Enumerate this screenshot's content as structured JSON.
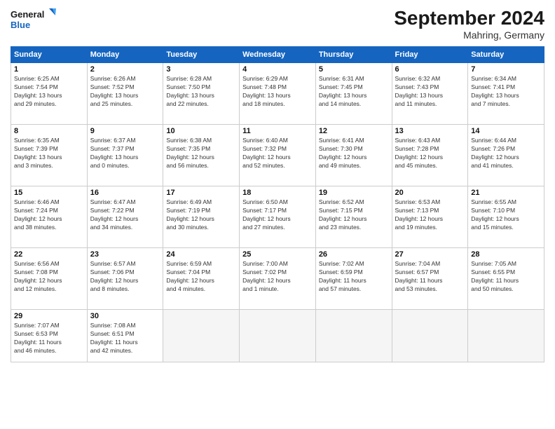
{
  "header": {
    "logo_line1": "General",
    "logo_line2": "Blue",
    "month": "September 2024",
    "location": "Mahring, Germany"
  },
  "columns": [
    "Sunday",
    "Monday",
    "Tuesday",
    "Wednesday",
    "Thursday",
    "Friday",
    "Saturday"
  ],
  "weeks": [
    [
      {
        "day": "1",
        "lines": [
          "Sunrise: 6:25 AM",
          "Sunset: 7:54 PM",
          "Daylight: 13 hours",
          "and 29 minutes."
        ]
      },
      {
        "day": "2",
        "lines": [
          "Sunrise: 6:26 AM",
          "Sunset: 7:52 PM",
          "Daylight: 13 hours",
          "and 25 minutes."
        ]
      },
      {
        "day": "3",
        "lines": [
          "Sunrise: 6:28 AM",
          "Sunset: 7:50 PM",
          "Daylight: 13 hours",
          "and 22 minutes."
        ]
      },
      {
        "day": "4",
        "lines": [
          "Sunrise: 6:29 AM",
          "Sunset: 7:48 PM",
          "Daylight: 13 hours",
          "and 18 minutes."
        ]
      },
      {
        "day": "5",
        "lines": [
          "Sunrise: 6:31 AM",
          "Sunset: 7:45 PM",
          "Daylight: 13 hours",
          "and 14 minutes."
        ]
      },
      {
        "day": "6",
        "lines": [
          "Sunrise: 6:32 AM",
          "Sunset: 7:43 PM",
          "Daylight: 13 hours",
          "and 11 minutes."
        ]
      },
      {
        "day": "7",
        "lines": [
          "Sunrise: 6:34 AM",
          "Sunset: 7:41 PM",
          "Daylight: 13 hours",
          "and 7 minutes."
        ]
      }
    ],
    [
      {
        "day": "8",
        "lines": [
          "Sunrise: 6:35 AM",
          "Sunset: 7:39 PM",
          "Daylight: 13 hours",
          "and 3 minutes."
        ]
      },
      {
        "day": "9",
        "lines": [
          "Sunrise: 6:37 AM",
          "Sunset: 7:37 PM",
          "Daylight: 13 hours",
          "and 0 minutes."
        ]
      },
      {
        "day": "10",
        "lines": [
          "Sunrise: 6:38 AM",
          "Sunset: 7:35 PM",
          "Daylight: 12 hours",
          "and 56 minutes."
        ]
      },
      {
        "day": "11",
        "lines": [
          "Sunrise: 6:40 AM",
          "Sunset: 7:32 PM",
          "Daylight: 12 hours",
          "and 52 minutes."
        ]
      },
      {
        "day": "12",
        "lines": [
          "Sunrise: 6:41 AM",
          "Sunset: 7:30 PM",
          "Daylight: 12 hours",
          "and 49 minutes."
        ]
      },
      {
        "day": "13",
        "lines": [
          "Sunrise: 6:43 AM",
          "Sunset: 7:28 PM",
          "Daylight: 12 hours",
          "and 45 minutes."
        ]
      },
      {
        "day": "14",
        "lines": [
          "Sunrise: 6:44 AM",
          "Sunset: 7:26 PM",
          "Daylight: 12 hours",
          "and 41 minutes."
        ]
      }
    ],
    [
      {
        "day": "15",
        "lines": [
          "Sunrise: 6:46 AM",
          "Sunset: 7:24 PM",
          "Daylight: 12 hours",
          "and 38 minutes."
        ]
      },
      {
        "day": "16",
        "lines": [
          "Sunrise: 6:47 AM",
          "Sunset: 7:22 PM",
          "Daylight: 12 hours",
          "and 34 minutes."
        ]
      },
      {
        "day": "17",
        "lines": [
          "Sunrise: 6:49 AM",
          "Sunset: 7:19 PM",
          "Daylight: 12 hours",
          "and 30 minutes."
        ]
      },
      {
        "day": "18",
        "lines": [
          "Sunrise: 6:50 AM",
          "Sunset: 7:17 PM",
          "Daylight: 12 hours",
          "and 27 minutes."
        ]
      },
      {
        "day": "19",
        "lines": [
          "Sunrise: 6:52 AM",
          "Sunset: 7:15 PM",
          "Daylight: 12 hours",
          "and 23 minutes."
        ]
      },
      {
        "day": "20",
        "lines": [
          "Sunrise: 6:53 AM",
          "Sunset: 7:13 PM",
          "Daylight: 12 hours",
          "and 19 minutes."
        ]
      },
      {
        "day": "21",
        "lines": [
          "Sunrise: 6:55 AM",
          "Sunset: 7:10 PM",
          "Daylight: 12 hours",
          "and 15 minutes."
        ]
      }
    ],
    [
      {
        "day": "22",
        "lines": [
          "Sunrise: 6:56 AM",
          "Sunset: 7:08 PM",
          "Daylight: 12 hours",
          "and 12 minutes."
        ]
      },
      {
        "day": "23",
        "lines": [
          "Sunrise: 6:57 AM",
          "Sunset: 7:06 PM",
          "Daylight: 12 hours",
          "and 8 minutes."
        ]
      },
      {
        "day": "24",
        "lines": [
          "Sunrise: 6:59 AM",
          "Sunset: 7:04 PM",
          "Daylight: 12 hours",
          "and 4 minutes."
        ]
      },
      {
        "day": "25",
        "lines": [
          "Sunrise: 7:00 AM",
          "Sunset: 7:02 PM",
          "Daylight: 12 hours",
          "and 1 minute."
        ]
      },
      {
        "day": "26",
        "lines": [
          "Sunrise: 7:02 AM",
          "Sunset: 6:59 PM",
          "Daylight: 11 hours",
          "and 57 minutes."
        ]
      },
      {
        "day": "27",
        "lines": [
          "Sunrise: 7:04 AM",
          "Sunset: 6:57 PM",
          "Daylight: 11 hours",
          "and 53 minutes."
        ]
      },
      {
        "day": "28",
        "lines": [
          "Sunrise: 7:05 AM",
          "Sunset: 6:55 PM",
          "Daylight: 11 hours",
          "and 50 minutes."
        ]
      }
    ],
    [
      {
        "day": "29",
        "lines": [
          "Sunrise: 7:07 AM",
          "Sunset: 6:53 PM",
          "Daylight: 11 hours",
          "and 46 minutes."
        ]
      },
      {
        "day": "30",
        "lines": [
          "Sunrise: 7:08 AM",
          "Sunset: 6:51 PM",
          "Daylight: 11 hours",
          "and 42 minutes."
        ]
      },
      {
        "day": "",
        "lines": []
      },
      {
        "day": "",
        "lines": []
      },
      {
        "day": "",
        "lines": []
      },
      {
        "day": "",
        "lines": []
      },
      {
        "day": "",
        "lines": []
      }
    ]
  ]
}
